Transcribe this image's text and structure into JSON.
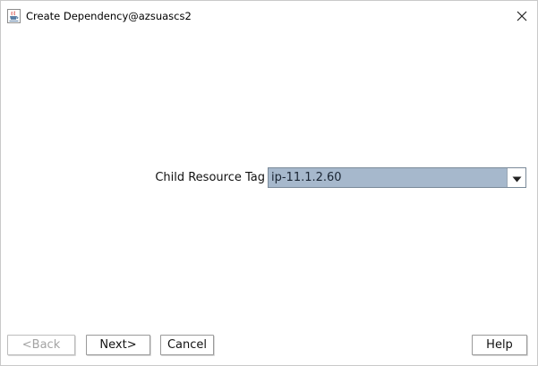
{
  "window": {
    "title": "Create Dependency@azsuascs2",
    "app_icon": "java-cup-icon",
    "close_icon": "close-icon"
  },
  "form": {
    "label": "Child Resource Tag",
    "selected_value": "ip-11.1.2.60",
    "dropdown_icon": "chevron-down-icon"
  },
  "buttons": {
    "back": "<Back",
    "next": "Next>",
    "cancel": "Cancel",
    "help": "Help"
  },
  "colors": {
    "combo_selected_bg": "#a6b8cc",
    "disabled_text": "#a3a3a3"
  }
}
